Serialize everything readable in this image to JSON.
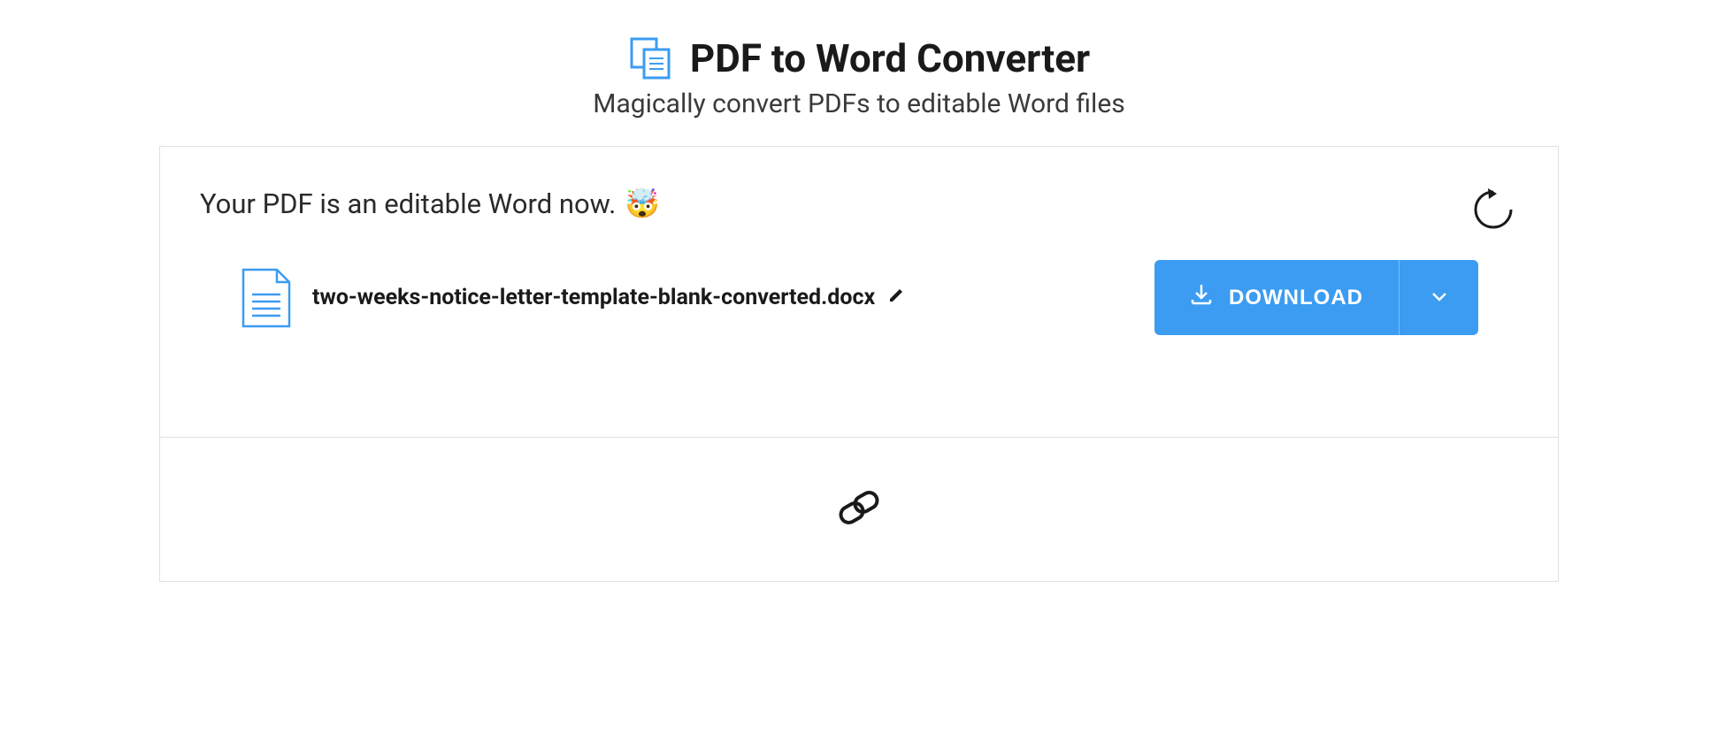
{
  "header": {
    "title": "PDF to Word Converter",
    "subtitle": "Magically convert PDFs to editable Word files"
  },
  "status": {
    "text": "Your PDF is an editable Word now.",
    "emoji": "🤯"
  },
  "file": {
    "name": "two-weeks-notice-letter-template-blank-converted.docx"
  },
  "actions": {
    "download_label": "DOWNLOAD"
  },
  "icons": {
    "header_icon": "copy-document-icon",
    "restart": "restart-icon",
    "file": "document-icon",
    "edit": "pencil-icon",
    "download": "download-icon",
    "dropdown": "chevron-down-icon",
    "link": "link-icon"
  },
  "colors": {
    "primary": "#3b9cf2",
    "text": "#1a1a1a",
    "border": "#e0e0e0"
  }
}
